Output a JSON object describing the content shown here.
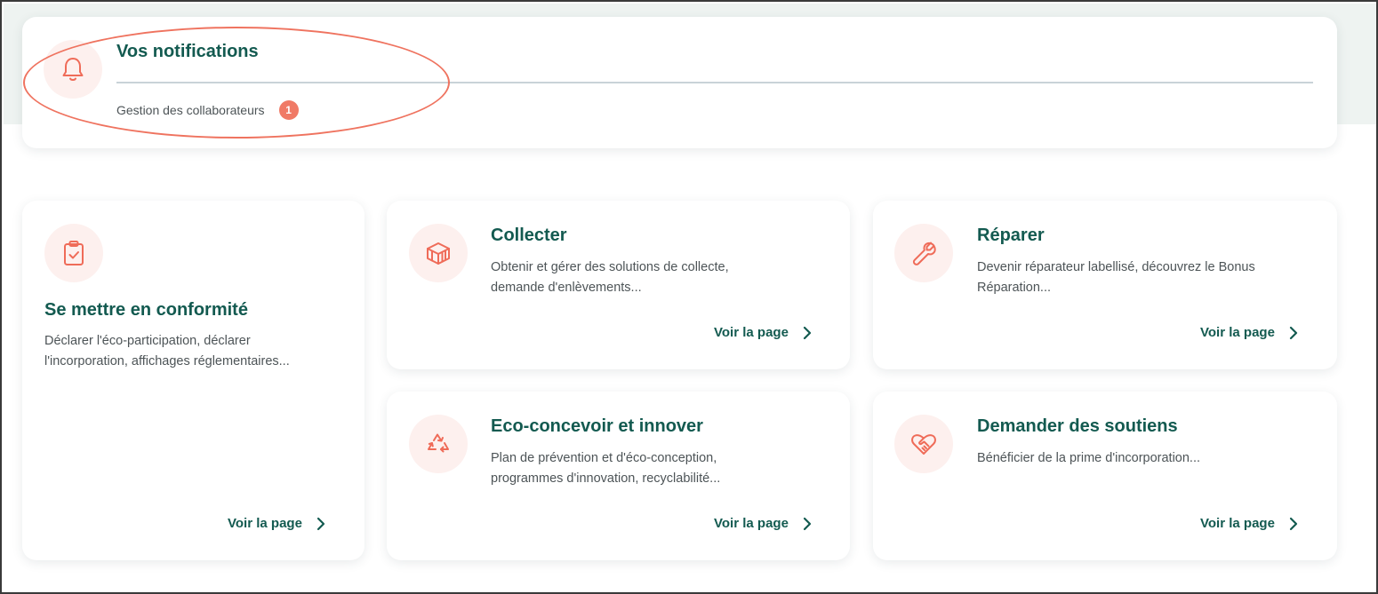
{
  "notifications": {
    "title": "Vos notifications",
    "icon": "bell-icon",
    "items": [
      {
        "label": "Gestion des collaborateurs",
        "count": "1"
      }
    ]
  },
  "tiles": [
    {
      "id": "conformite",
      "icon": "clipboard-check-icon",
      "title": "Se mettre en conformité",
      "description_lines": [
        "Déclarer l'éco-participation, déclarer",
        "l'incorporation, affichages réglementaires..."
      ],
      "link": "Voir la page"
    },
    {
      "id": "collecter",
      "icon": "box-icon",
      "title": "Collecter",
      "description_lines": [
        "Obtenir et gérer des solutions de collecte,",
        "demande d'enlèvements..."
      ],
      "link": "Voir la page"
    },
    {
      "id": "reparer",
      "icon": "wrench-icon",
      "title": "Réparer",
      "description_lines": [
        "Devenir réparateur labellisé, découvrez le Bonus",
        "Réparation..."
      ],
      "link": "Voir la page"
    },
    {
      "id": "eco-concevoir",
      "icon": "recycle-icon",
      "title": "Eco-concevoir et innover",
      "description_lines": [
        "Plan de prévention et d'éco-conception,",
        "programmes d'innovation, recyclabilité..."
      ],
      "link": "Voir la page"
    },
    {
      "id": "soutiens",
      "icon": "heart-handshake-icon",
      "title": "Demander des soutiens",
      "description_lines": [
        "Bénéficier de la prime d'incorporation..."
      ],
      "link": "Voir la page"
    }
  ],
  "colors": {
    "brand_green": "#135a50",
    "accent_coral": "#f07a66",
    "icon_bg": "#fdf0ee",
    "text_grey": "#4d5457"
  }
}
